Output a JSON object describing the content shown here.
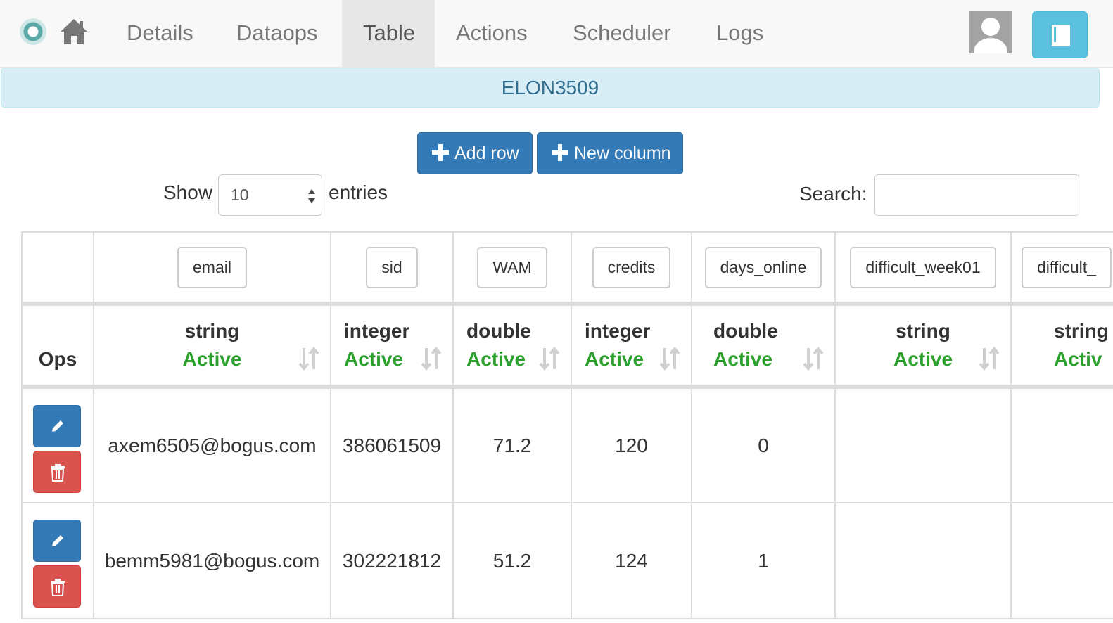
{
  "nav": {
    "items": [
      "Details",
      "Dataops",
      "Table",
      "Actions",
      "Scheduler",
      "Logs"
    ],
    "active": "Table"
  },
  "banner": {
    "title": "ELON3509"
  },
  "toolbar": {
    "add_row_label": "Add row",
    "new_column_label": "New column"
  },
  "length": {
    "show_label": "Show",
    "value": "10",
    "entries_label": "entries"
  },
  "search": {
    "label": "Search:",
    "value": ""
  },
  "table": {
    "ops_header": "Ops",
    "columns": [
      {
        "name": "email",
        "type": "string",
        "status": "Active"
      },
      {
        "name": "sid",
        "type": "integer",
        "status": "Active"
      },
      {
        "name": "WAM",
        "type": "double",
        "status": "Active"
      },
      {
        "name": "credits",
        "type": "integer",
        "status": "Active"
      },
      {
        "name": "days_online",
        "type": "double",
        "status": "Active"
      },
      {
        "name": "difficult_week01",
        "type": "string",
        "status": "Active"
      },
      {
        "name": "difficult_",
        "type": "string",
        "status": "Activ"
      }
    ],
    "rows": [
      {
        "email": "axem6505@bogus.com",
        "sid": "386061509",
        "WAM": "71.2",
        "credits": "120",
        "days_online": "0",
        "difficult_week01": "",
        "difficult_": ""
      },
      {
        "email": "bemm5981@bogus.com",
        "sid": "302221812",
        "WAM": "51.2",
        "credits": "124",
        "days_online": "1",
        "difficult_week01": "",
        "difficult_": ""
      }
    ]
  },
  "colors": {
    "primary": "#337ab7",
    "danger": "#d9534f",
    "info": "#5bc0de",
    "active_status": "#2ca02c",
    "banner_bg": "#d9edf7",
    "banner_text": "#31708f"
  },
  "icons": {
    "logo": "app-logo-icon",
    "home": "home-icon",
    "avatar": "user-avatar-icon",
    "book": "book-icon",
    "plus": "plus-icon",
    "sort": "sort-icon",
    "edit": "pencil-icon",
    "delete": "trash-icon"
  }
}
